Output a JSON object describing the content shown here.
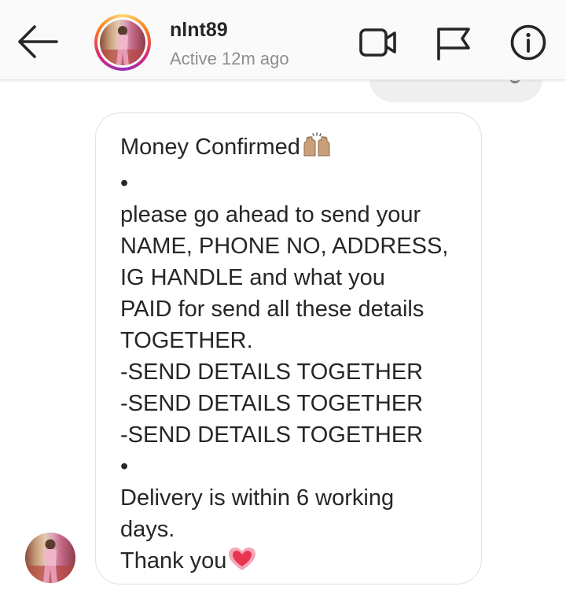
{
  "header": {
    "username": "nlnt89",
    "status": "Active 12m ago",
    "icons": [
      "back-arrow-icon",
      "video-call-icon",
      "flag-icon",
      "info-icon"
    ]
  },
  "message": {
    "lines": [
      "Money Confirmed",
      "•",
      "please go ahead to send your",
      "NAME, PHONE NO, ADDRESS,",
      "IG HANDLE and what you",
      "PAID for send all these details",
      "TOGETHER.",
      "-SEND DETAILS TOGETHER",
      "-SEND DETAILS TOGETHER",
      "-SEND DETAILS TOGETHER",
      "•",
      "Delivery is within 6 working",
      "days.",
      "Thank you"
    ],
    "emojis": {
      "line0": "raising-hands-emoji",
      "line13": "heart-emoji"
    }
  },
  "colors": {
    "text": "#262626",
    "secondary": "#8e8e8e",
    "bubble_border": "#e0e0e0",
    "prev_bubble": "#efefef",
    "story_ring": [
      "#feda75",
      "#fa7e1e",
      "#d62976",
      "#962fbf"
    ]
  }
}
